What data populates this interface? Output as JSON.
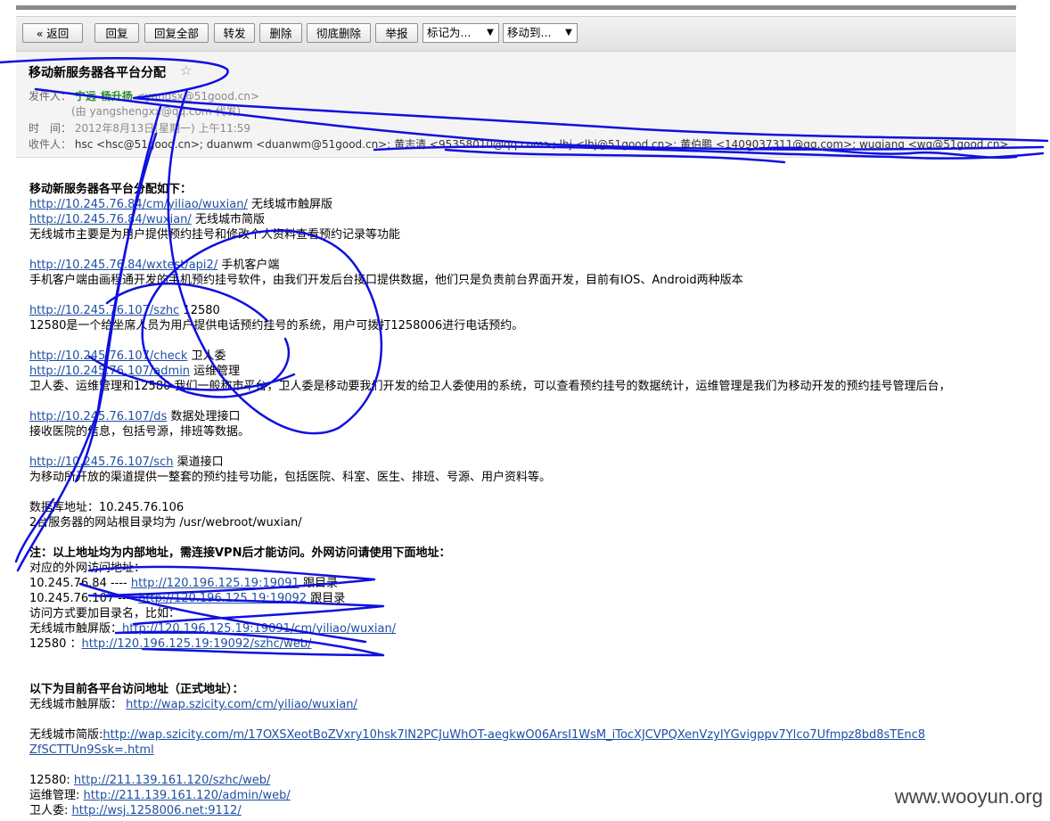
{
  "toolbar": {
    "back": "« 返回",
    "reply": "回复",
    "reply_all": "回复全部",
    "forward": "转发",
    "delete": "删除",
    "delete_forever": "彻底删除",
    "report": "举报",
    "mark_as": "标记为...",
    "move_to": "移动到..."
  },
  "header": {
    "subject": "移动新服务器各平台分配",
    "star": "☆",
    "from_label": "发件人：",
    "from_name": "宁远-杨升扬",
    "from_email": "<yangsx@51good.cn>",
    "on_behalf": "(由 yangshengxx@qq.com 代发)",
    "time_label": "时　间：",
    "time_value": "2012年8月13日(星期一) 上午11:59",
    "to_label": "收件人：",
    "to_value": "hsc <hsc@51good.cn>; duanwm <duanwm@51good.cn>; 黄志清 <95358010@qq.com>; lhj <lhj@51good.cn>; 黄伯鹏 <1409037311@qq.com>; wuqiang <wq@51good.cn>"
  },
  "body": {
    "heading": "移动新服务器各平台分配如下：",
    "l1_link": "http://10.245.76.84/cm/yiliao/wuxian/",
    "l1_text": " 无线城市触屏版",
    "l2_link": "http://10.245.76.84/wuxian/",
    "l2_text": "  无线城市简版",
    "l3": "无线城市主要是为用户提供预约挂号和修改个人资料查看预约记录等功能",
    "l4_link": "http://10.245.76.84/wxtest/api2/",
    "l4_text": "  手机客户端",
    "l5": "手机客户端由画程通开发的手机预约挂号软件，由我们开发后台接口提供数据，他们只是负责前台界面开发，目前有IOS、Android两种版本",
    "l6_link": "http://10.245.76.107/szhc",
    "l6_text": "  12580",
    "l7": "12580是一个给坐席人员为用户提供电话预约挂号的系统，用户可拨打1258006进行电话预约。",
    "l8_link": "http://10.245.76.107/check",
    "l8_text": "  卫人委",
    "l9_link": "http://10.245.76.107/admin",
    "l9_text": "  运维管理",
    "l10": "卫人委、运维管理和12580 我们一般称市平台，卫人委是移动要我们开发的给卫人委使用的系统，可以查看预约挂号的数据统计，运维管理是我们为移动开发的预约挂号管理后台，",
    "l11_link": "http://10.245.76.107/ds",
    "l11_text": "  数据处理接口",
    "l12": "接收医院的信息，包括号源，排班等数据。",
    "l13_link": "http://10.245.76.107/sch",
    "l13_text": "  渠道接口",
    "l14": "为移动所开放的渠道提供一整套的预约挂号功能，包括医院、科室、医生、排班、号源、用户资料等。",
    "l15": "数据库地址：10.245.76.106",
    "l16": "2台服务器的网站根目录均为  /usr/webroot/wuxian/",
    "note": "注：以上地址均为内部地址，需连接VPN后才能访问。外网访问请使用下面地址：",
    "l17": "对应的外网访问地址：",
    "l18_pre": "10.245.76.84  ---- ",
    "l18_link": "http://120.196.125.19:19091",
    "l18_text": "   跟目录",
    "l19_pre": "10.245.76.107  ---- ",
    "l19_link": "http://120.196.125.19:19092",
    "l19_text": "   跟目录",
    "l20": "访问方式要加目录名，比如：",
    "l21_pre": "无线城市触屏版：",
    "l21_link": "http://120.196.125.19:19091/cm/yiliao/wuxian/",
    "l22_pre": "12580 ：",
    "l22_link": "http://120.196.125.19:19092/szhc/web/",
    "heading2": "以下为目前各平台访问地址（正式地址）：",
    "l23_pre": "无线城市触屏版：  ",
    "l23_link": "http://wap.szicity.com/cm/yiliao/wuxian/",
    "l24_pre": "无线城市简版:",
    "l24_link": "http://wap.szicity.com/m/17OXSXeotBoZVxry10hsk7lN2PCJuWhOT-aegkwO06ArsI1WsM_iTocXJCVPQXenVzyIYGvigppv7Ylco7Ufmpz8bd8sTEnc8",
    "l24_link2": "ZfSCTTUn9Ssk=.html",
    "l25_pre": "12580:  ",
    "l25_link": "http://211.139.161.120/szhc/web/",
    "l26_pre": "运维管理: ",
    "l26_link": "http://211.139.161.120/admin/web/",
    "l27_pre": "卫人委: ",
    "l27_link": "http://wsj.1258006.net:9112/"
  },
  "watermark": "www.wooyun.org",
  "colors": {
    "link": "#1f4fa3",
    "scribble": "#1010e0",
    "sender": "#2a8b2a"
  }
}
